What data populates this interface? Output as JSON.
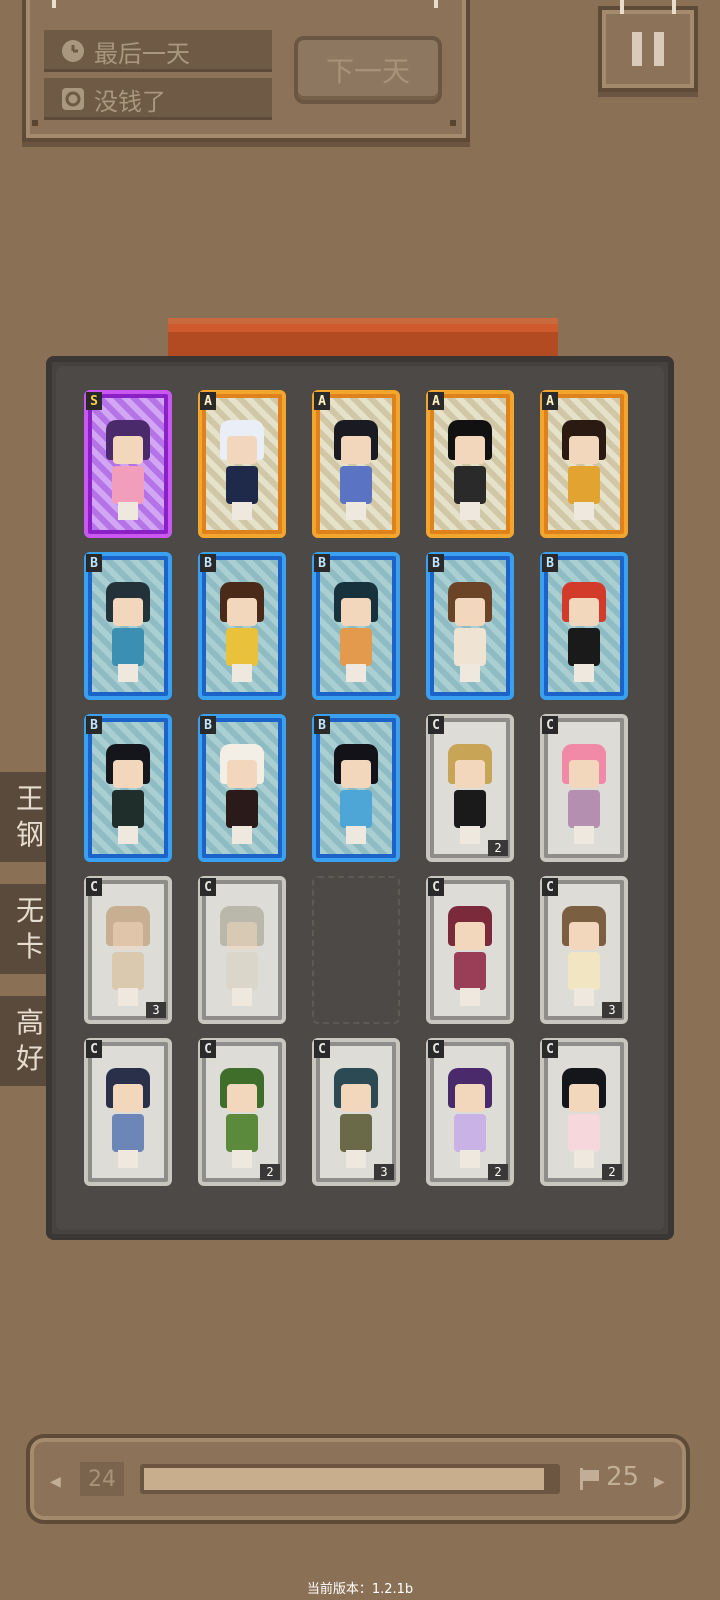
{
  "top": {
    "day_status": "最后一天",
    "money_status": "没钱了",
    "next_day_label": "下一天"
  },
  "side_tabs": [
    {
      "line1": "王",
      "line2": "钢"
    },
    {
      "line1": "无",
      "line2": "卡"
    },
    {
      "line1": "高",
      "line2": "好"
    }
  ],
  "cards": [
    {
      "rarity": "S",
      "hair": "#4a2a6a",
      "outfit": "#f29dbb",
      "count": ""
    },
    {
      "rarity": "A",
      "hair": "#e9eef7",
      "outfit": "#1f2a4a",
      "count": ""
    },
    {
      "rarity": "A",
      "hair": "#1a1a22",
      "outfit": "#5a73c2",
      "count": ""
    },
    {
      "rarity": "A",
      "hair": "#111111",
      "outfit": "#2a2a2a",
      "count": ""
    },
    {
      "rarity": "A",
      "hair": "#2b1a12",
      "outfit": "#e3a330",
      "count": ""
    },
    {
      "rarity": "B",
      "hair": "#233238",
      "outfit": "#3a8fb3",
      "count": ""
    },
    {
      "rarity": "B",
      "hair": "#4a2a18",
      "outfit": "#e9c13a",
      "count": ""
    },
    {
      "rarity": "B",
      "hair": "#17323c",
      "outfit": "#e39a4c",
      "count": ""
    },
    {
      "rarity": "B",
      "hair": "#6b4428",
      "outfit": "#efe4d3",
      "count": ""
    },
    {
      "rarity": "B",
      "hair": "#d23a2a",
      "outfit": "#1a1a1a",
      "count": ""
    },
    {
      "rarity": "B",
      "hair": "#15151c",
      "outfit": "#1f2e2a",
      "count": ""
    },
    {
      "rarity": "B",
      "hair": "#f4efe6",
      "outfit": "#2a1a1a",
      "count": ""
    },
    {
      "rarity": "B",
      "hair": "#121218",
      "outfit": "#4ea6d6",
      "count": ""
    },
    {
      "rarity": "C",
      "hair": "#c7a456",
      "outfit": "#1a1a1a",
      "count": "2"
    },
    {
      "rarity": "C",
      "hair": "#f08aa6",
      "outfit": "#b58fb0",
      "count": ""
    },
    {
      "rarity": "C",
      "hair": "#b88a5a",
      "outfit": "#d8b98e",
      "count": "3",
      "faded": true
    },
    {
      "rarity": "C",
      "hair": "#9a9a86",
      "outfit": "#d7d3bf",
      "count": "",
      "faded": true
    },
    {
      "rarity": "empty"
    },
    {
      "rarity": "C",
      "hair": "#7a2a3a",
      "outfit": "#9a3d56",
      "count": ""
    },
    {
      "rarity": "C",
      "hair": "#7a6040",
      "outfit": "#f2e6c2",
      "count": "3"
    },
    {
      "rarity": "C",
      "hair": "#2a2f4a",
      "outfit": "#6c86b8",
      "count": ""
    },
    {
      "rarity": "C",
      "hair": "#3f6e2a",
      "outfit": "#5a8a3a",
      "count": "2"
    },
    {
      "rarity": "C",
      "hair": "#2c4a54",
      "outfit": "#6b6a48",
      "count": "3"
    },
    {
      "rarity": "C",
      "hair": "#4a2a6a",
      "outfit": "#c9b3e6",
      "count": "2"
    },
    {
      "rarity": "C",
      "hair": "#15151c",
      "outfit": "#f6d8dc",
      "count": "2"
    }
  ],
  "progress": {
    "current_level": "24",
    "next_level": "25",
    "fill_fraction": 0.97
  },
  "version_text": "当前版本：1.2.1b",
  "colors": {
    "background": "#8a7155",
    "grid_panel": "#454240",
    "book_tab": "#b24a22"
  }
}
